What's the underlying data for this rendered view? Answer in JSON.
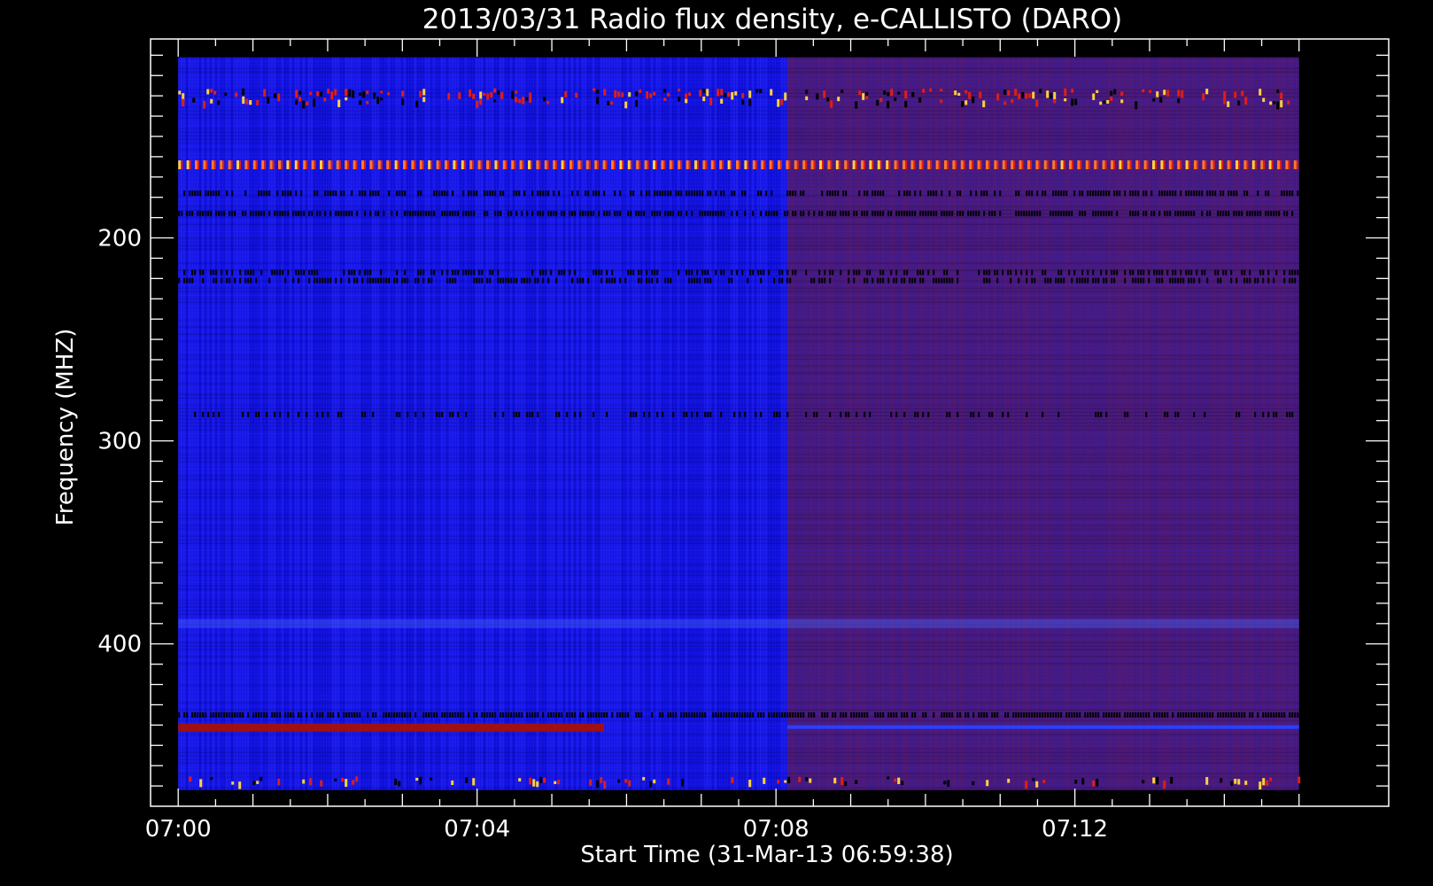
{
  "chart_data": {
    "type": "heatmap",
    "title": "2013/03/31  Radio flux density, e-CALLISTO (DARO)",
    "xlabel": "Start Time (31-Mar-13 06:59:38)",
    "ylabel": "Frequency (MHZ)",
    "x_ticks": [
      "07:00",
      "07:04",
      "07:08",
      "07:12"
    ],
    "x_tick_minutes": [
      0,
      4,
      8,
      12
    ],
    "x_range_minutes": [
      -0.37,
      16.2
    ],
    "data_x_range_minutes": [
      0,
      15
    ],
    "y_ticks": [
      200,
      300,
      400
    ],
    "y_range_mhz": [
      102,
      480
    ],
    "data_y_range_mhz": [
      111,
      472
    ],
    "y_axis_inverted": true,
    "colors": {
      "segment1": "#1414e6",
      "segment2": "#4a1a7a",
      "bright": "#ffd23c",
      "red": "#e01e14"
    },
    "segments": [
      {
        "start_min": 0,
        "end_min": 8.15,
        "background": "blue"
      },
      {
        "start_min": 8.15,
        "end_min": 15,
        "background": "purple"
      }
    ],
    "bands": [
      {
        "freq_mhz": 128,
        "kind": "bursty",
        "intensity": 0.9
      },
      {
        "freq_mhz": 132,
        "kind": "bursty",
        "intensity": 0.7
      },
      {
        "freq_mhz": 164,
        "kind": "dashed",
        "intensity": 1.0
      },
      {
        "freq_mhz": 178,
        "kind": "dark",
        "intensity": 0.6
      },
      {
        "freq_mhz": 188,
        "kind": "dark",
        "intensity": 0.7
      },
      {
        "freq_mhz": 217,
        "kind": "dark",
        "intensity": 0.5
      },
      {
        "freq_mhz": 221,
        "kind": "dark",
        "intensity": 0.5
      },
      {
        "freq_mhz": 287,
        "kind": "dark",
        "intensity": 0.3
      },
      {
        "freq_mhz": 390,
        "kind": "light",
        "intensity": 0.4
      },
      {
        "freq_mhz": 435,
        "kind": "dark",
        "intensity": 0.8
      },
      {
        "freq_mhz": 441,
        "kind": "red",
        "intensity": 0.9
      },
      {
        "freq_mhz": 467,
        "kind": "bursty",
        "intensity": 0.6
      }
    ]
  }
}
